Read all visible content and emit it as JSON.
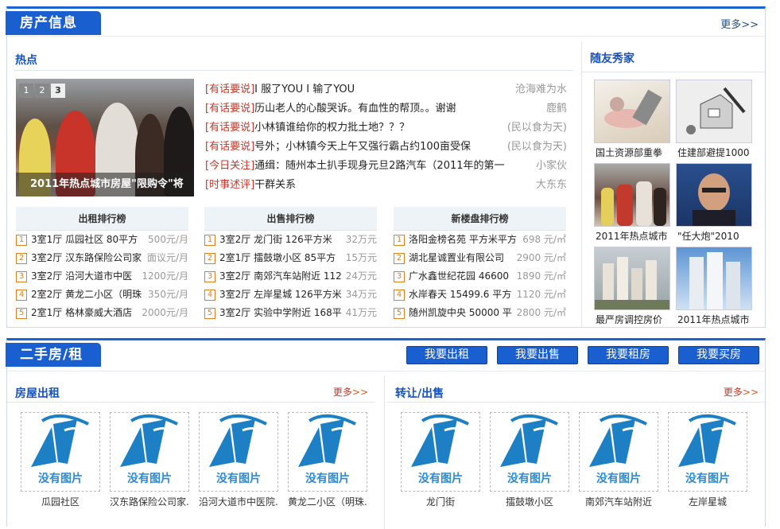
{
  "property": {
    "tab": "房产信息",
    "more": "更多>>",
    "hot_title": "热点",
    "feature": {
      "caption": "2011年热点城市房屋\"限购令\"将",
      "pages": [
        "1",
        "2",
        "3"
      ]
    },
    "news": [
      {
        "tag": "[有话要说]",
        "text": "I 服了YOU I 输了YOU",
        "author": "沧海难为水"
      },
      {
        "tag": "[有话要说]",
        "text": "历山老人的心酸哭诉。有血性的帮顶。。谢谢",
        "author": "鹿鹤"
      },
      {
        "tag": "[有话要说]",
        "text": "小林镇谁给你的权力批土地？？？",
        "author": "(民以食为天)"
      },
      {
        "tag": "[有话要说]",
        "text": "号外；小林镇今天上午又强行霸占约100亩受保",
        "author": "(民以食为天)"
      },
      {
        "tag": "[今日关注]",
        "text": "通缉：随州本土扒手现身元旦2路汽车（2011年的第一",
        "author": "小家伙"
      },
      {
        "tag": "[时事述评]",
        "text": "干群关系",
        "author": "大东东"
      }
    ],
    "rankings": [
      {
        "title": "出租排行榜",
        "rows": [
          {
            "n": "1",
            "name": "3室1厅 瓜园社区 80平方",
            "price": "500元/月"
          },
          {
            "n": "2",
            "name": "3室2厅 汉东路保险公司家",
            "price": "面议元/月"
          },
          {
            "n": "3",
            "name": "3室2厅 沿河大道市中医",
            "price": "1200元/月"
          },
          {
            "n": "4",
            "name": "2室2厅 黄龙二小区（明珠",
            "price": "350元/月"
          },
          {
            "n": "5",
            "name": "2室1厅 格林豪威大酒店",
            "price": "2000元/月"
          }
        ]
      },
      {
        "title": "出售排行榜",
        "rows": [
          {
            "n": "1",
            "name": "3室2厅 龙门街 126平方米",
            "price": "32万元"
          },
          {
            "n": "2",
            "name": "2室1厅 擂鼓墩小区 85平方",
            "price": "15万元"
          },
          {
            "n": "3",
            "name": "3室2厅 南郊汽车站附近 112",
            "price": "24万元"
          },
          {
            "n": "4",
            "name": "3室2厅 左岸星城 126平方米",
            "price": "34万元"
          },
          {
            "n": "5",
            "name": "3室2厅 实验中学附近 168平",
            "price": "41万元"
          }
        ]
      },
      {
        "title": "新楼盘排行榜",
        "rows": [
          {
            "n": "1",
            "name": "洛阳金榜名苑 平方米平方",
            "price": "698 元/㎡"
          },
          {
            "n": "2",
            "name": "湖北星诚置业有限公司",
            "price": "2900 元/㎡"
          },
          {
            "n": "3",
            "name": "广水鑫世纪花园 46600",
            "price": "1890 元/㎡"
          },
          {
            "n": "4",
            "name": "水岸春天 15499.6 平方",
            "price": "1120 元/㎡"
          },
          {
            "n": "5",
            "name": "随州凯旋中央 50000 平",
            "price": "2800 元/㎡"
          }
        ]
      }
    ],
    "side": {
      "title": "随友秀家",
      "items": [
        {
          "caption": "国土资源部重拳"
        },
        {
          "caption": "住建部避提1000"
        },
        {
          "caption": "2011年热点城市"
        },
        {
          "caption": "\"任大炮\"2010"
        },
        {
          "caption": "最严房调控房价"
        },
        {
          "caption": "2011年热点城市"
        }
      ]
    }
  },
  "secondhand": {
    "tab": "二手房/租房",
    "buttons": [
      "我要出租",
      "我要出售",
      "我要租房",
      "我要买房"
    ],
    "rent": {
      "title": "房屋出租",
      "more": "更多",
      "arrow": ">>",
      "cards": [
        "瓜园社区",
        "汉东路保险公司家...",
        "沿河大道市中医院...",
        "黄龙二小区（明珠..."
      ]
    },
    "sale": {
      "title": "转让/出售",
      "more": "更多",
      "arrow": ">>",
      "cards": [
        "龙门街",
        "擂鼓墩小区",
        "南郊汽车站附近",
        "左岸星城"
      ]
    },
    "no_image": "没有图片"
  }
}
